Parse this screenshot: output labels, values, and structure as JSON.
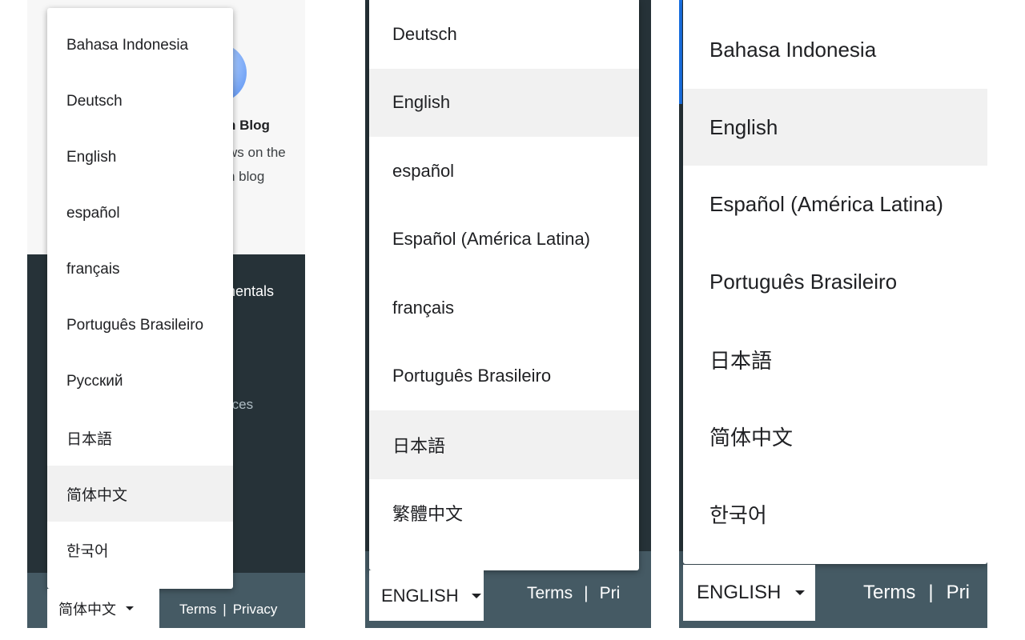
{
  "panel1": {
    "blog_title": "n Blog",
    "blog_desc_line1": "ws on the",
    "blog_desc_line2": "n blog",
    "fundamentals": "nentals",
    "resources": "rces",
    "menu_items": [
      "Bahasa Indonesia",
      "Deutsch",
      "English",
      "español",
      "français",
      "Português Brasileiro",
      "Русский",
      "日本語",
      "简体中文",
      "한국어"
    ],
    "highlighted_index": 8,
    "lang_button": "简体中文",
    "terms": "Terms",
    "separator": "|",
    "privacy": "Privacy"
  },
  "panel2": {
    "menu_items": [
      "Deutsch",
      "English",
      "español",
      "Español (América Latina)",
      "français",
      "Português Brasileiro",
      "日本語",
      "繁體中文"
    ],
    "highlighted_indices": [
      1,
      6
    ],
    "lang_button": "ENGLISH",
    "terms": "Terms",
    "separator": "|",
    "privacy": "Pri"
  },
  "panel3": {
    "menu_items": [
      "Bahasa Indonesia",
      "English",
      "Español (América Latina)",
      "Português Brasileiro",
      "日本語",
      "简体中文",
      "한국어"
    ],
    "highlighted_index": 1,
    "lang_button": "ENGLISH",
    "terms": "Terms",
    "separator": "|",
    "privacy": "Pri"
  },
  "colors": {
    "footer_dark": "#263238",
    "footer_bar": "#455a64",
    "highlight": "#f1f1f1",
    "accent": "#1a73e8"
  }
}
